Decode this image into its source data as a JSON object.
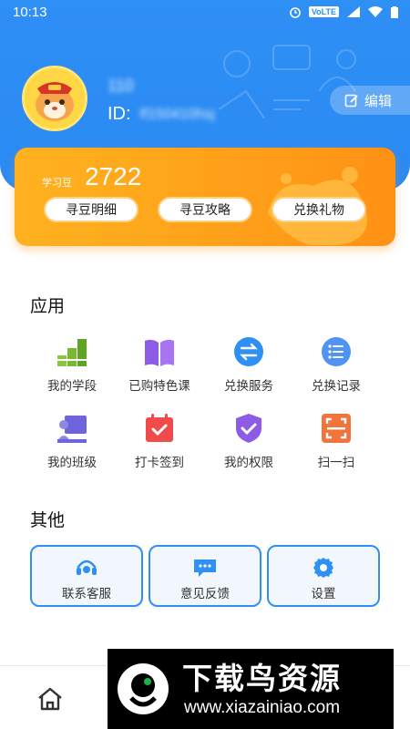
{
  "status_bar": {
    "time": "10:13",
    "network": "VoLTE",
    "icons": [
      "alarm-icon",
      "signal-icon",
      "wifi-icon",
      "battery-icon"
    ]
  },
  "profile": {
    "username": "110",
    "id_label": "ID:",
    "id_value": "lf150410hsj",
    "edit_label": "编辑"
  },
  "points": {
    "label": "学习豆",
    "value": "2722",
    "buttons": [
      "寻豆明细",
      "寻豆攻略",
      "兑换礼物"
    ]
  },
  "apps": {
    "title": "应用",
    "items": [
      {
        "label": "我的学段",
        "icon": "stairs-icon"
      },
      {
        "label": "已购特色课",
        "icon": "book-icon"
      },
      {
        "label": "兑换服务",
        "icon": "exchange-icon"
      },
      {
        "label": "兑换记录",
        "icon": "list-icon"
      },
      {
        "label": "我的班级",
        "icon": "class-icon"
      },
      {
        "label": "打卡签到",
        "icon": "calendar-check-icon"
      },
      {
        "label": "我的权限",
        "icon": "shield-icon"
      },
      {
        "label": "扫一扫",
        "icon": "scan-icon"
      }
    ]
  },
  "other": {
    "title": "其他",
    "items": [
      {
        "label": "联系客服",
        "icon": "headset-icon"
      },
      {
        "label": "意见反馈",
        "icon": "feedback-icon"
      },
      {
        "label": "设置",
        "icon": "gear-icon"
      }
    ]
  },
  "watermark": {
    "title": "下载鸟资源",
    "url": "www.xiazainiao.com"
  },
  "colors": {
    "primary": "#2e8ff5",
    "points_card": "#ffa11a",
    "watermark_bg": "#000000"
  }
}
